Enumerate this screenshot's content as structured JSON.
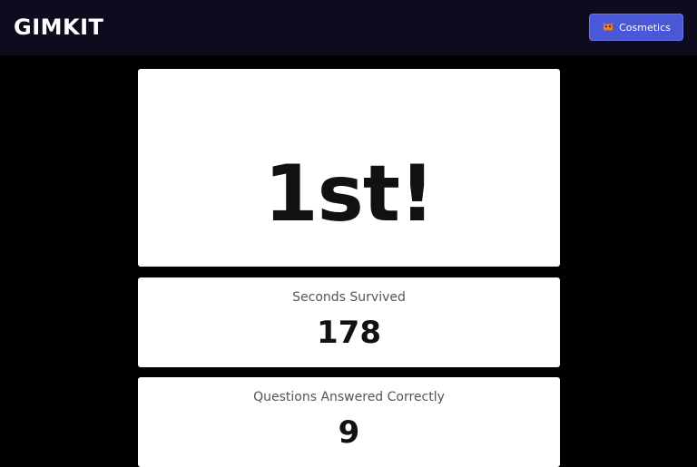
{
  "header": {
    "logo_text": "GIMKIT",
    "cosmetics_label": "Cosmetics",
    "cosmetics_icon": "orange-monster-icon"
  },
  "results": {
    "place": "1st!",
    "stats": [
      {
        "label": "Seconds Survived",
        "value": "178"
      },
      {
        "label": "Questions Answered Correctly",
        "value": "9"
      }
    ]
  },
  "colors": {
    "background": "#000000",
    "topbar": "#0f0b1f",
    "button": "#4a57d6",
    "card": "#ffffff",
    "icon": "#f0822a"
  }
}
